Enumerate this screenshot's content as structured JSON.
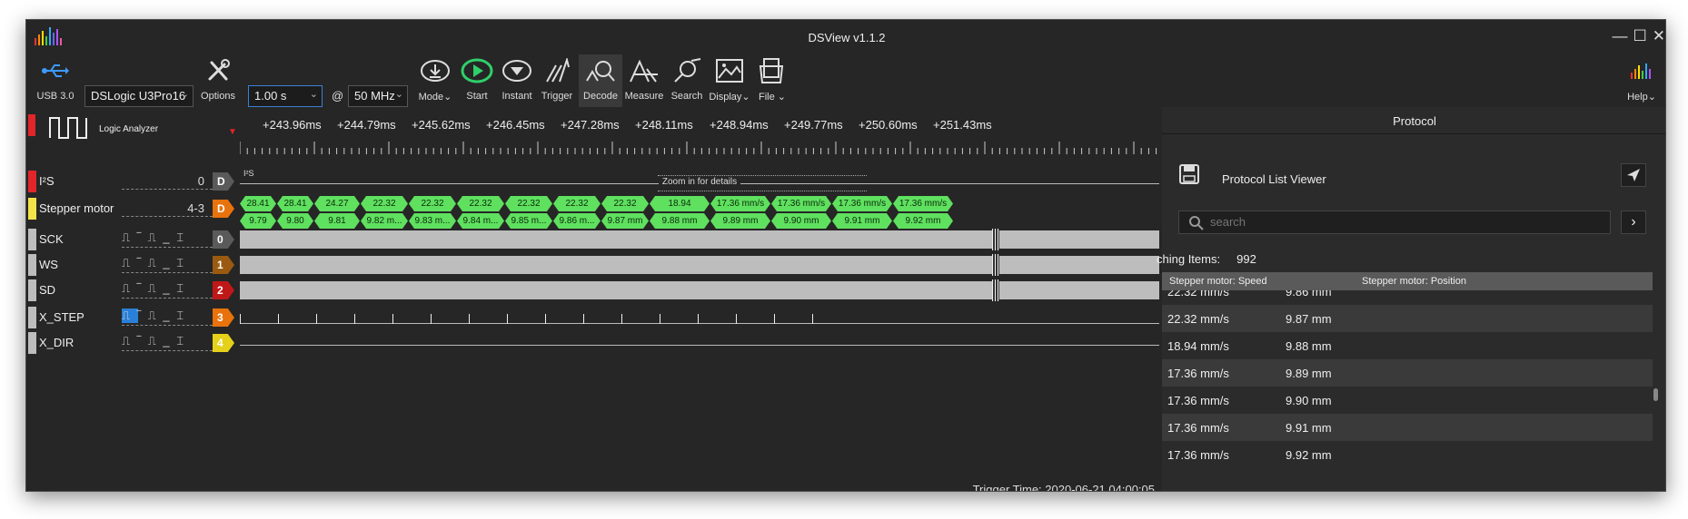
{
  "window": {
    "title": "DSView v1.1.2"
  },
  "toolbar": {
    "usb_label": "USB 3.0",
    "device": "DSLogic U3Pro16",
    "options_label": "Options",
    "duration": "1.00 s",
    "at": "@",
    "samplerate": "50 MHz",
    "mode_label": "Mode",
    "start_label": "Start",
    "instant_label": "Instant",
    "trigger_label": "Trigger",
    "decode_label": "Decode",
    "measure_label": "Measure",
    "search_label": "Search",
    "display_label": "Display",
    "file_label": "File",
    "help_label": "Help"
  },
  "ruler": {
    "panel_label": "Logic Analyzer",
    "ticks": [
      "+243.96ms",
      "+244.79ms",
      "+245.62ms",
      "+246.45ms",
      "+247.28ms",
      "+248.11ms",
      "+248.94ms",
      "+249.77ms",
      "+250.60ms",
      "+251.43ms"
    ]
  },
  "channels": [
    {
      "name": "I²S",
      "range": "0",
      "id": "D",
      "color": "#e0262a",
      "idcolor": "#5a5a5a"
    },
    {
      "name": "Stepper motor",
      "range": "4-3",
      "id": "D",
      "color": "#f3e24a",
      "idcolor": "#e8720c"
    },
    {
      "name": "SCK",
      "id": "0",
      "color": "#bdbdbd",
      "idcolor": "#5a5a5a"
    },
    {
      "name": "WS",
      "id": "1",
      "color": "#bdbdbd",
      "idcolor": "#9a5a10"
    },
    {
      "name": "SD",
      "id": "2",
      "color": "#bdbdbd",
      "idcolor": "#c01818"
    },
    {
      "name": "X_STEP",
      "id": "3",
      "color": "#bdbdbd",
      "idcolor": "#e8720c"
    },
    {
      "name": "X_DIR",
      "id": "4",
      "color": "#bdbdbd",
      "idcolor": "#e6d11a"
    }
  ],
  "trigger_icons": "⎍ ‾ ⎍ _ ⌶",
  "i2s_decoder": {
    "label": "I²S",
    "zoom_hint": "Zoom in for details"
  },
  "stepper": {
    "speed": [
      "28.41",
      "28.41",
      "24.27",
      "22.32",
      "22.32",
      "22.32",
      "22.32",
      "22.32",
      "22.32",
      "18.94",
      "17.36 mm/s",
      "17.36 mm/s",
      "17.36 mm/s",
      "17.36 mm/s"
    ],
    "position": [
      "9.79",
      "9.80",
      "9.81",
      "9.82 m...",
      "9.83 m...",
      "9.84 m...",
      "9.85 m...",
      "9.86 m...",
      "9.87 mm",
      "9.88 mm",
      "9.89 mm",
      "9.90 mm",
      "9.91 mm",
      "9.92 mm"
    ]
  },
  "trigger_time": "Trigger Time: 2020-06-21 04:00:05",
  "protocol": {
    "panel_title": "Protocol",
    "viewer_title": "Protocol List Viewer",
    "search_placeholder": "search",
    "matching_label": "ching Items:",
    "matching_count": "992",
    "col_speed": "Stepper motor: Speed",
    "col_position": "Stepper motor: Position",
    "rows": [
      {
        "speed": "22.32 mm/s",
        "position": "9.86 mm"
      },
      {
        "speed": "22.32 mm/s",
        "position": "9.87 mm"
      },
      {
        "speed": "18.94 mm/s",
        "position": "9.88 mm"
      },
      {
        "speed": "17.36 mm/s",
        "position": "9.89 mm"
      },
      {
        "speed": "17.36 mm/s",
        "position": "9.90 mm"
      },
      {
        "speed": "17.36 mm/s",
        "position": "9.91 mm"
      },
      {
        "speed": "17.36 mm/s",
        "position": "9.92 mm"
      }
    ]
  }
}
